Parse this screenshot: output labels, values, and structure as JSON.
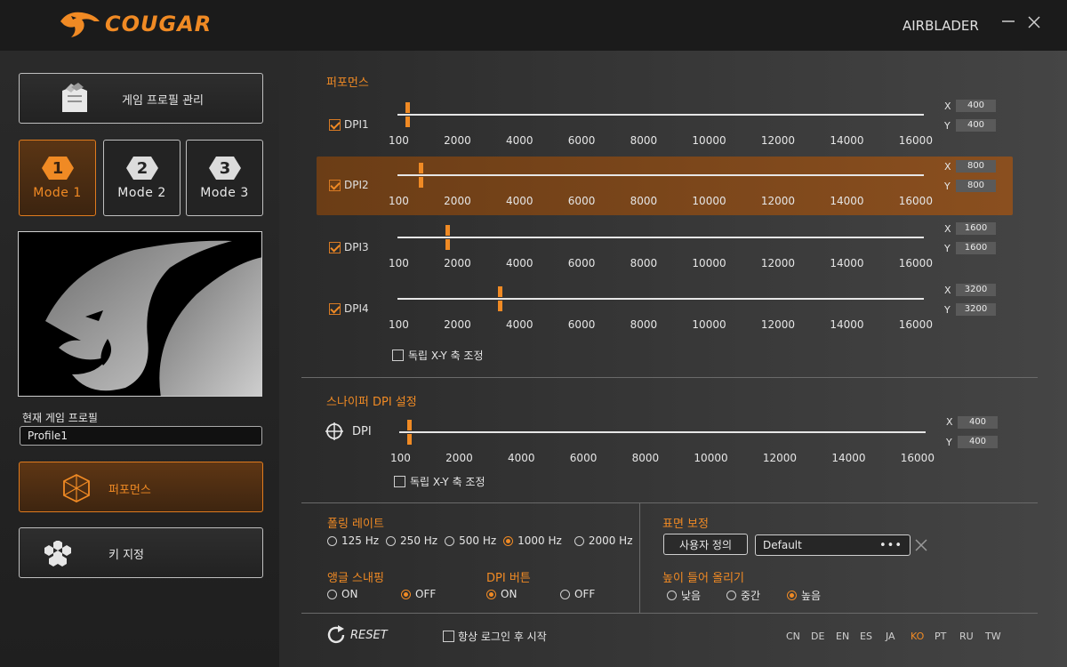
{
  "app": {
    "brand": "COUGAR",
    "product": "AIRBLADER",
    "minimize_icon": "minimize-icon",
    "close_icon": "close-icon",
    "accent": "#f08a24"
  },
  "sidebar": {
    "profile_manage_label": "게임 프로필 관리",
    "modes": [
      {
        "num": "1",
        "label": "Mode 1",
        "active": true
      },
      {
        "num": "2",
        "label": "Mode 2",
        "active": false
      },
      {
        "num": "3",
        "label": "Mode 3",
        "active": false
      }
    ],
    "current_profile_label": "현재 게임 프로필",
    "current_profile_value": "Profile1",
    "nav": [
      {
        "label": "퍼포먼스",
        "icon": "cube-icon",
        "active": true
      },
      {
        "label": "키 지정",
        "icon": "hexagons-icon",
        "active": false
      }
    ]
  },
  "performance": {
    "title": "퍼포먼스",
    "ticks": [
      "100",
      "2000",
      "4000",
      "6000",
      "8000",
      "10000",
      "12000",
      "14000",
      "16000"
    ],
    "rows": [
      {
        "name": "DPI1",
        "checked": true,
        "selected": false,
        "value": 400,
        "x": "400",
        "y": "400"
      },
      {
        "name": "DPI2",
        "checked": true,
        "selected": true,
        "value": 800,
        "x": "800",
        "y": "800"
      },
      {
        "name": "DPI3",
        "checked": true,
        "selected": false,
        "value": 1600,
        "x": "1600",
        "y": "1600"
      },
      {
        "name": "DPI4",
        "checked": true,
        "selected": false,
        "value": 3200,
        "x": "3200",
        "y": "3200"
      }
    ],
    "x_label": "X",
    "y_label": "Y",
    "independent_xy": "독립 X-Y 축 조정"
  },
  "sniper": {
    "title": "스나이퍼 DPI 설정",
    "label": "DPI",
    "value": 400,
    "x": "400",
    "y": "400",
    "independent_xy": "독립 X-Y 축 조정"
  },
  "polling": {
    "title": "폴링 레이트",
    "options": [
      "125 Hz",
      "250 Hz",
      "500 Hz",
      "1000 Hz",
      "2000 Hz"
    ],
    "selected": "1000 Hz"
  },
  "angle_snapping": {
    "title": "앵글 스내핑",
    "on": "ON",
    "off": "OFF",
    "selected": "OFF"
  },
  "dpi_button": {
    "title": "DPI 버튼",
    "on": "ON",
    "off": "OFF",
    "selected": "ON"
  },
  "surface": {
    "title": "표면 보정",
    "custom_button": "사용자 정의",
    "preset": "Default",
    "more_label": "•••"
  },
  "lift_off": {
    "title": "높이 들어 올리기",
    "options": [
      "낮음",
      "중간",
      "높음"
    ],
    "selected": "높음"
  },
  "footer": {
    "reset": "RESET",
    "autostart": "항상 로그인 후 시작",
    "languages": [
      "CN",
      "DE",
      "EN",
      "ES",
      "JA",
      "KO",
      "PT",
      "RU",
      "TW"
    ],
    "active_language": "KO"
  }
}
